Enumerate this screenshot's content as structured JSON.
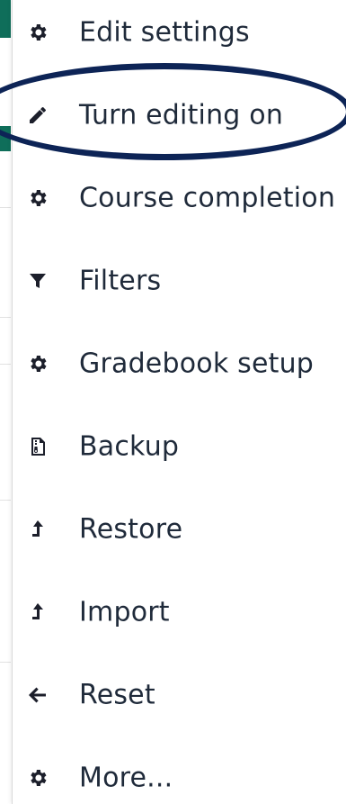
{
  "menu": {
    "items": [
      {
        "label": "Edit settings",
        "icon": "gear-icon"
      },
      {
        "label": "Turn editing on",
        "icon": "pencil-icon"
      },
      {
        "label": "Course completion",
        "icon": "gear-icon"
      },
      {
        "label": "Filters",
        "icon": "filter-icon"
      },
      {
        "label": "Gradebook setup",
        "icon": "gear-icon"
      },
      {
        "label": "Backup",
        "icon": "file-archive-icon"
      },
      {
        "label": "Restore",
        "icon": "level-up-icon"
      },
      {
        "label": "Import",
        "icon": "level-up-icon"
      },
      {
        "label": "Reset",
        "icon": "arrow-left-icon"
      },
      {
        "label": "More...",
        "icon": "gear-icon"
      }
    ]
  },
  "colors": {
    "highlight_ring": "#0d2456",
    "text": "#1f2a3a",
    "icon": "#1c1f2b",
    "page_accent": "#0f6e5a"
  }
}
